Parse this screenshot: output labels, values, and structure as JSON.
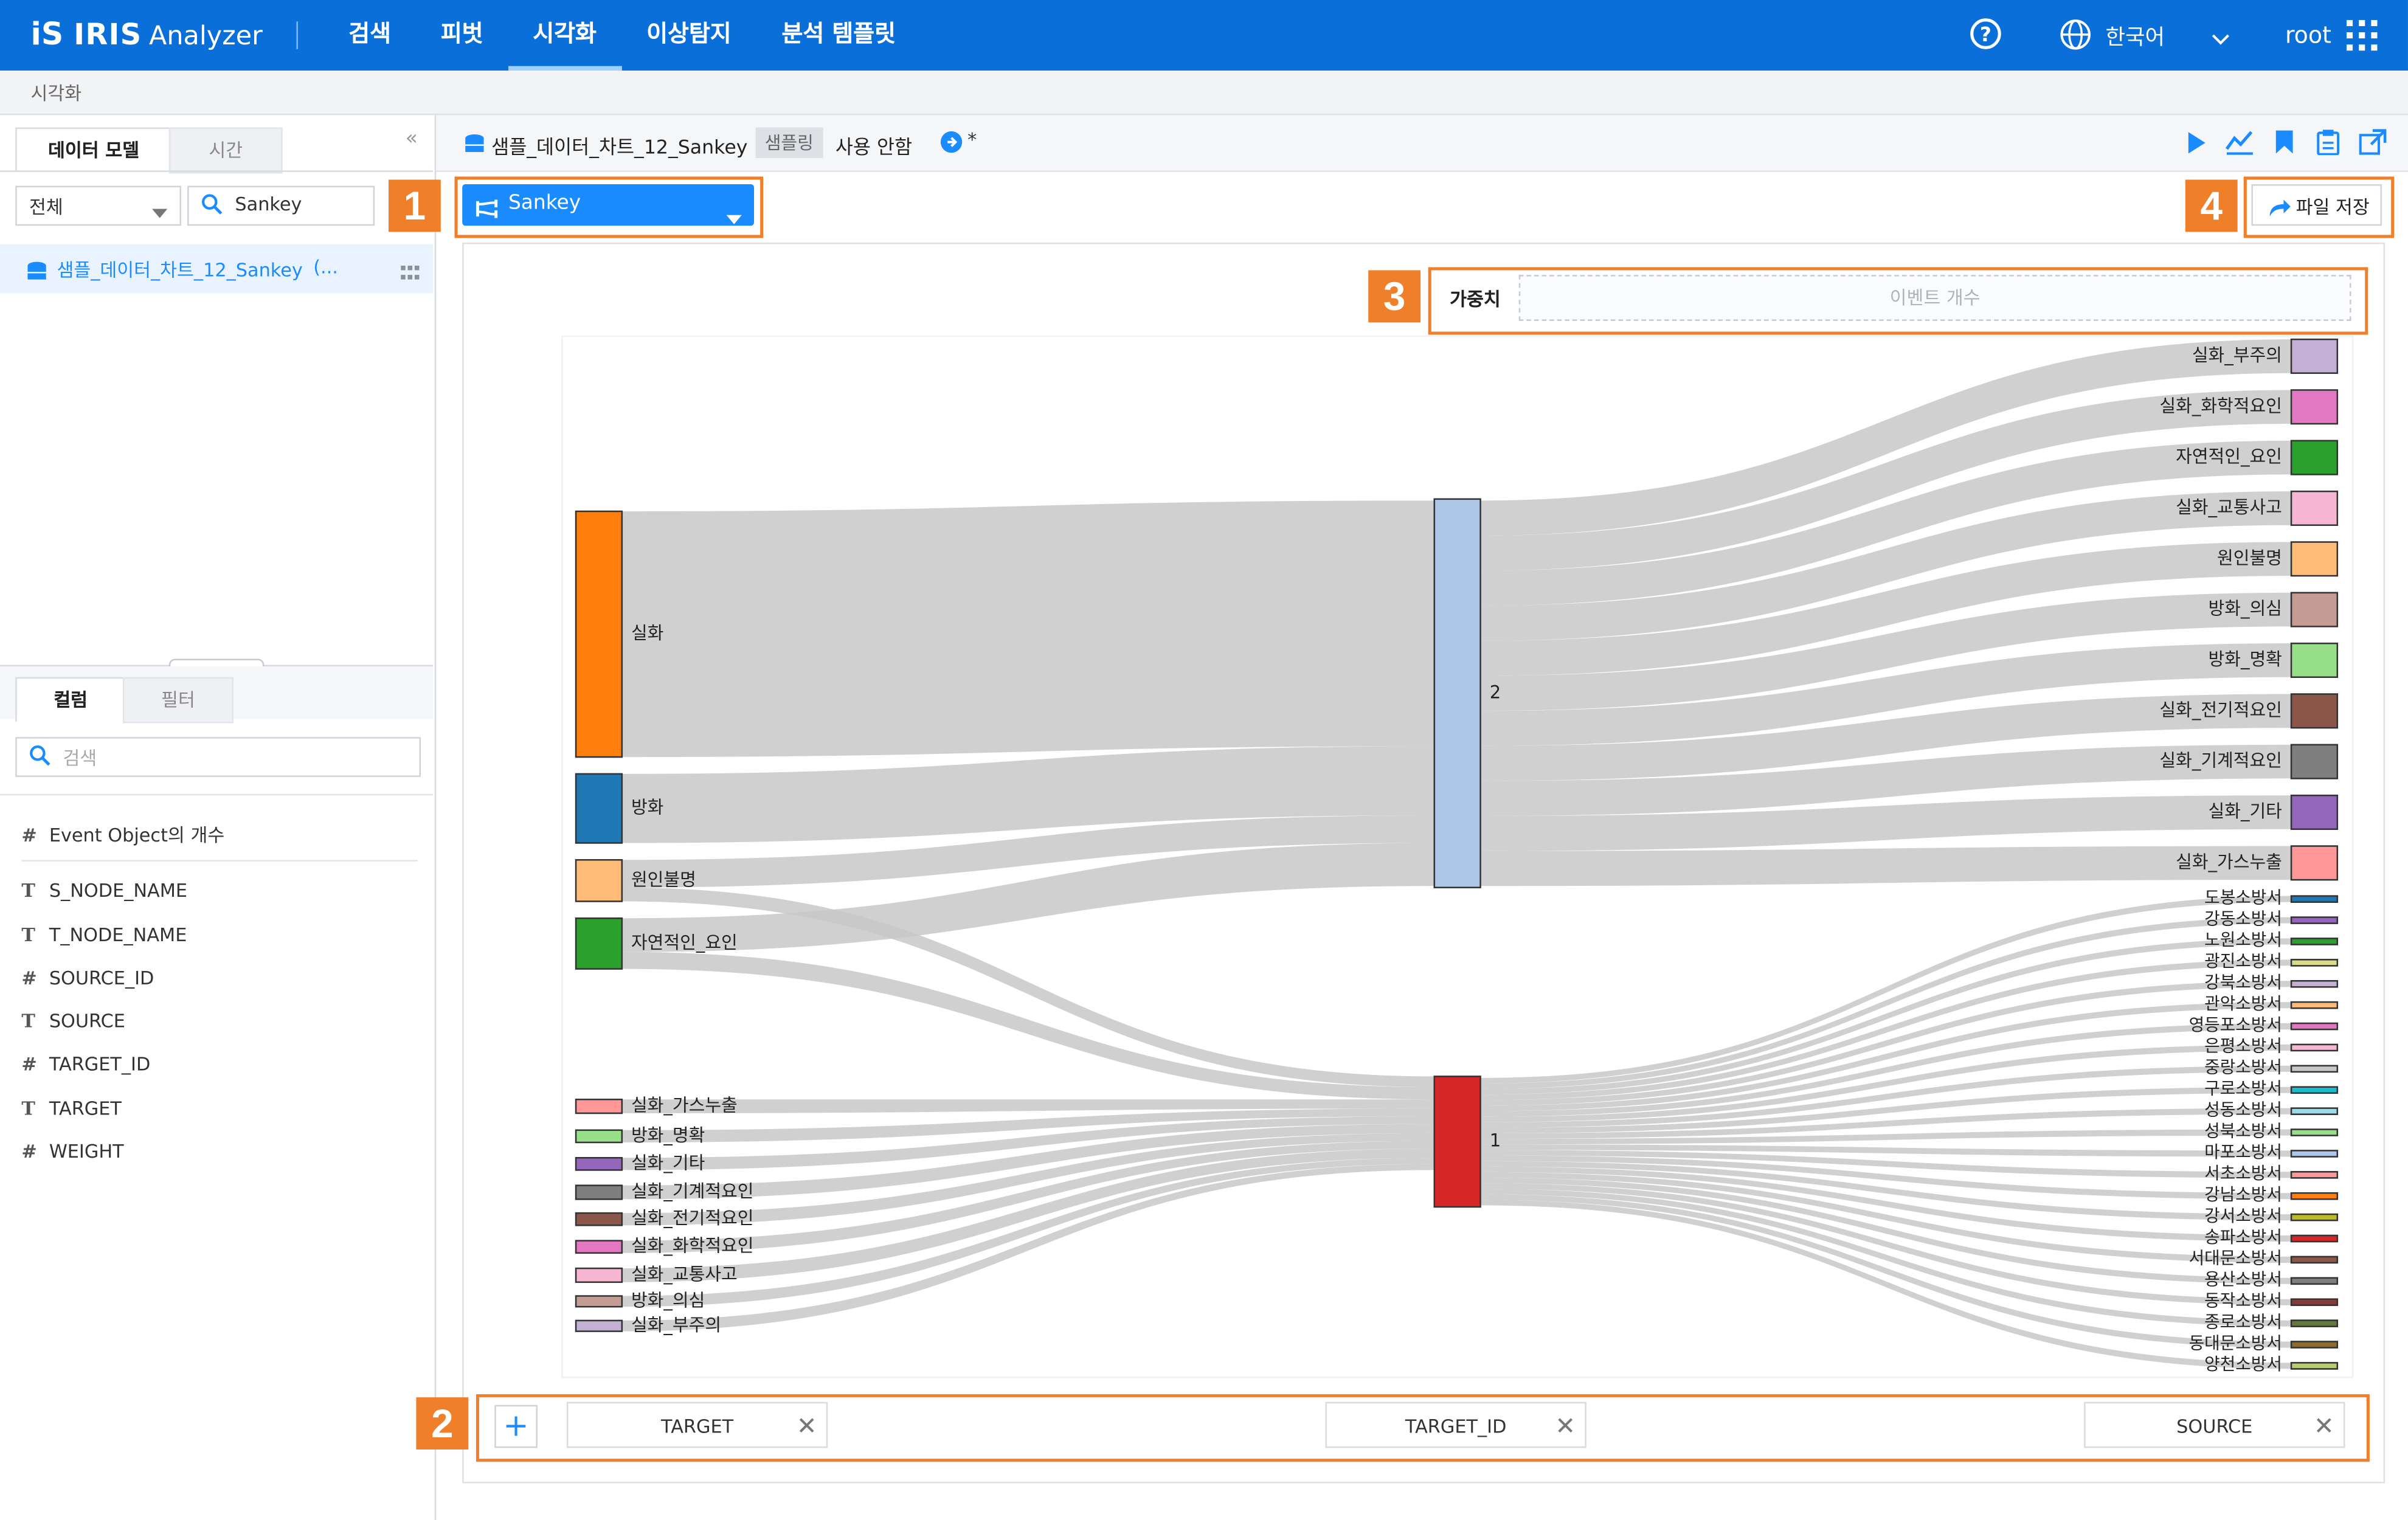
{
  "header": {
    "logo_mark": "iS",
    "logo_name": "IRIS",
    "logo_sub": "Analyzer",
    "nav": [
      "검색",
      "피벗",
      "시각화",
      "이상탐지",
      "분석 템플릿"
    ],
    "active_nav": "시각화",
    "language": "한국어",
    "user": "root"
  },
  "breadcrumb": "시각화",
  "left_panel": {
    "tabs": [
      "데이터 모델",
      "시간"
    ],
    "scope_select": "전체",
    "search_value": "Sankey",
    "model_item": "샘플_데이터_차트_12_Sankey",
    "model_more": "(...",
    "column_tabs": [
      "컬럼",
      "필터"
    ],
    "column_search_placeholder": "검색",
    "fields": [
      {
        "type": "#",
        "name": "Event Object의 개수"
      },
      {
        "type": "T",
        "name": "S_NODE_NAME"
      },
      {
        "type": "T",
        "name": "T_NODE_NAME"
      },
      {
        "type": "#",
        "name": "SOURCE_ID"
      },
      {
        "type": "T",
        "name": "SOURCE"
      },
      {
        "type": "#",
        "name": "TARGET_ID"
      },
      {
        "type": "T",
        "name": "TARGET"
      },
      {
        "type": "#",
        "name": "WEIGHT"
      }
    ]
  },
  "main": {
    "model_title": "샘플_데이터_차트_12_Sankey",
    "sampling_label": "샘플링",
    "sampling_value": "사용 안함",
    "modified_marker": "*",
    "chart_type": "Sankey",
    "save_file": "파일 저장",
    "weight_label": "가중치",
    "weight_placeholder": "이벤트 개수",
    "callouts": [
      "1",
      "2",
      "3",
      "4"
    ],
    "axis_fields": [
      "TARGET",
      "TARGET_ID",
      "SOURCE"
    ]
  },
  "colors": {
    "topbar": "#0a6fd9",
    "accent": "#1a8cff",
    "callout": "#f07f2a",
    "link": "#c8c8c8"
  },
  "chart_data": {
    "type": "sankey",
    "sources": [
      {
        "name": "실화",
        "color": "#ff7f0e"
      },
      {
        "name": "방화",
        "color": "#1f77b4"
      },
      {
        "name": "원인불명",
        "color": "#ffbb78"
      },
      {
        "name": "자연적인_요인",
        "color": "#2ca02c"
      },
      {
        "name": "실화_가스누출",
        "color": "#ff9896"
      },
      {
        "name": "방화_명확",
        "color": "#98df8a"
      },
      {
        "name": "실화_기타",
        "color": "#9467bd"
      },
      {
        "name": "실화_기계적요인",
        "color": "#7f7f7f"
      },
      {
        "name": "실화_전기적요인",
        "color": "#8c564b"
      },
      {
        "name": "실화_화학적요인",
        "color": "#e377c2"
      },
      {
        "name": "실화_교통사고",
        "color": "#f7b6d2"
      },
      {
        "name": "방화_의심",
        "color": "#c49c94"
      },
      {
        "name": "실화_부주의",
        "color": "#c5b0d5"
      }
    ],
    "middle": [
      {
        "name": "2",
        "color": "#aec7e8"
      },
      {
        "name": "1",
        "color": "#d62728"
      }
    ],
    "targets_major": [
      {
        "name": "실화_부주의",
        "color": "#c5b0d5"
      },
      {
        "name": "실화_화학적요인",
        "color": "#e377c2"
      },
      {
        "name": "자연적인_요인",
        "color": "#2ca02c"
      },
      {
        "name": "실화_교통사고",
        "color": "#f7b6d2"
      },
      {
        "name": "원인불명",
        "color": "#ffbb78"
      },
      {
        "name": "방화_의심",
        "color": "#c49c94"
      },
      {
        "name": "방화_명확",
        "color": "#98df8a"
      },
      {
        "name": "실화_전기적요인",
        "color": "#8c564b"
      },
      {
        "name": "실화_기계적요인",
        "color": "#7f7f7f"
      },
      {
        "name": "실화_기타",
        "color": "#9467bd"
      },
      {
        "name": "실화_가스누출",
        "color": "#ff9896"
      }
    ],
    "targets_minor": [
      {
        "name": "도봉소방서",
        "color": "#1f77b4"
      },
      {
        "name": "강동소방서",
        "color": "#9467bd"
      },
      {
        "name": "노원소방서",
        "color": "#2ca02c"
      },
      {
        "name": "광진소방서",
        "color": "#dbdb8d"
      },
      {
        "name": "강북소방서",
        "color": "#c5b0d5"
      },
      {
        "name": "관악소방서",
        "color": "#ffbb78"
      },
      {
        "name": "영등포소방서",
        "color": "#e377c2"
      },
      {
        "name": "은평소방서",
        "color": "#f7b6d2"
      },
      {
        "name": "중랑소방서",
        "color": "#c7c7c7"
      },
      {
        "name": "구로소방서",
        "color": "#17becf"
      },
      {
        "name": "성동소방서",
        "color": "#9edae5"
      },
      {
        "name": "성북소방서",
        "color": "#98df8a"
      },
      {
        "name": "마포소방서",
        "color": "#aec7e8"
      },
      {
        "name": "서초소방서",
        "color": "#ff9896"
      },
      {
        "name": "강남소방서",
        "color": "#ff7f0e"
      },
      {
        "name": "강서소방서",
        "color": "#bcbd22"
      },
      {
        "name": "송파소방서",
        "color": "#d62728"
      },
      {
        "name": "서대문소방서",
        "color": "#8c564b"
      },
      {
        "name": "용산소방서",
        "color": "#7f7f7f"
      },
      {
        "name": "동작소방서",
        "color": "#843c39"
      },
      {
        "name": "종로소방서",
        "color": "#637939"
      },
      {
        "name": "동대문소방서",
        "color": "#8c6d31"
      },
      {
        "name": "양천소방서",
        "color": "#b5cf6b"
      }
    ]
  }
}
